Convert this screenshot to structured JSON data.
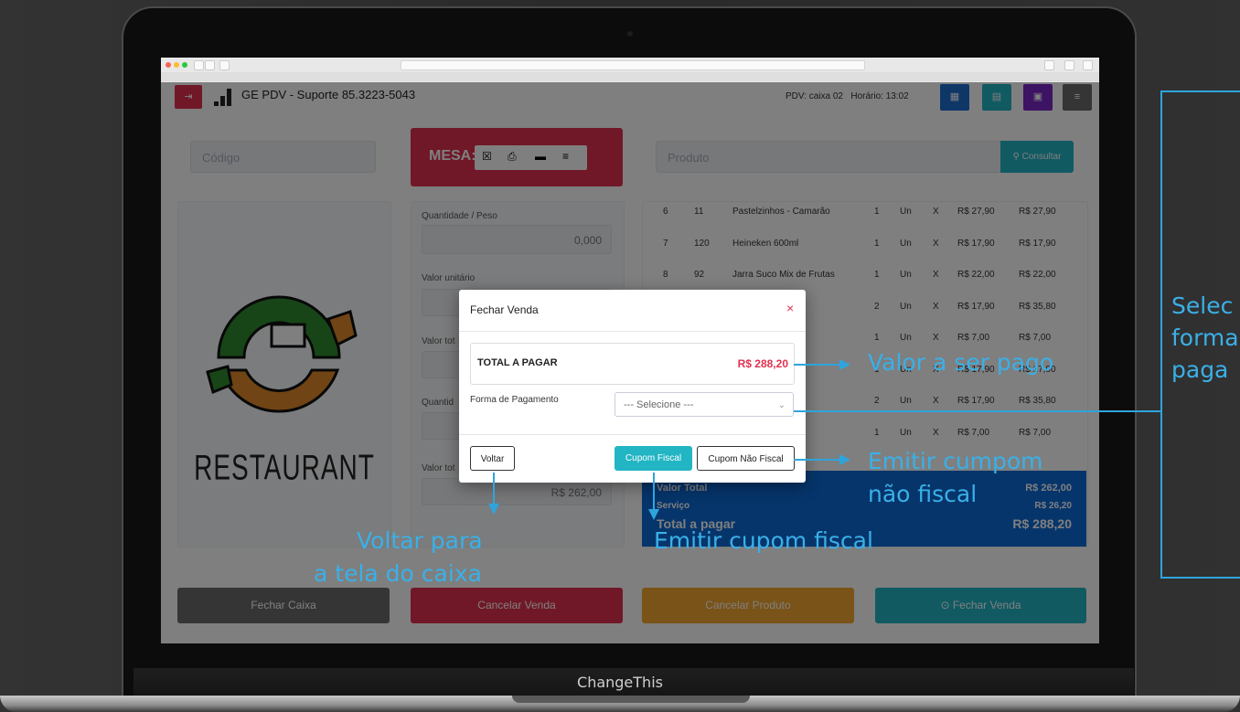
{
  "app": {
    "title": "GE PDV - Suporte 85.3223-5043",
    "pdv_label": "PDV: caixa 02",
    "time_label": "Horário: 13:02",
    "colors": {
      "red": "#e0314f",
      "blue": "#1d6fd0",
      "teal": "#22b5c4",
      "purple": "#7a27c9",
      "gray": "#6b6b6b",
      "orange": "#f2a62f"
    }
  },
  "search": {
    "codigo_placeholder": "Código",
    "produto_placeholder": "Produto",
    "consultar_label": "Consultar"
  },
  "mesa": {
    "label": "MESA:"
  },
  "form": {
    "qty_label": "Quantidade / Peso",
    "qty_value": "0,000",
    "unit_label": "Valor unitário",
    "total_label_short": "Valor tot",
    "qty_label_short": "Quantid",
    "total_label_short2": "Valor tot",
    "valor_total_value": "R$ 262,00"
  },
  "logo": {
    "text": "RESTAURANT"
  },
  "items": [
    {
      "n": "6",
      "cod": "11",
      "desc": "Pastelzinhos - Camarão",
      "qtd": "1",
      "un": "Un",
      "x": "X",
      "unit": "R$ 27,90",
      "total": "R$ 27,90"
    },
    {
      "n": "7",
      "cod": "120",
      "desc": "Heineken 600ml",
      "qtd": "1",
      "un": "Un",
      "x": "X",
      "unit": "R$ 17,90",
      "total": "R$ 17,90"
    },
    {
      "n": "8",
      "cod": "92",
      "desc": "Jarra Suco Mix de Frutas",
      "qtd": "1",
      "un": "Un",
      "x": "X",
      "unit": "R$ 22,00",
      "total": "R$ 22,00"
    },
    {
      "n": "",
      "cod": "",
      "desc": "",
      "qtd": "2",
      "un": "Un",
      "x": "X",
      "unit": "R$ 17,90",
      "total": "R$ 35,80"
    },
    {
      "n": "",
      "cod": "",
      "desc": "",
      "qtd": "1",
      "un": "Un",
      "x": "X",
      "unit": "R$ 7,00",
      "total": "R$ 7,00"
    },
    {
      "n": "",
      "cod": "",
      "desc": "",
      "qtd": "1",
      "un": "Un",
      "x": "X",
      "unit": "R$ 17,90",
      "total": "R$ 17,90"
    },
    {
      "n": "",
      "cod": "",
      "desc": "",
      "qtd": "2",
      "un": "Un",
      "x": "X",
      "unit": "R$ 17,90",
      "total": "R$ 35,80"
    },
    {
      "n": "",
      "cod": "",
      "desc": "",
      "qtd": "1",
      "un": "Un",
      "x": "X",
      "unit": "R$ 7,00",
      "total": "R$ 7,00"
    }
  ],
  "summary": {
    "valor_total_label": "Valor Total",
    "valor_total": "R$ 262,00",
    "servico_label": "Serviço",
    "servico": "R$ 26,20",
    "total_pagar_label": "Total a pagar",
    "total_pagar": "R$ 288,20"
  },
  "actions": {
    "fechar_caixa": "Fechar Caixa",
    "cancelar_venda": "Cancelar Venda",
    "cancelar_produto": "Cancelar Produto",
    "fechar_venda": "Fechar Venda"
  },
  "modal": {
    "title": "Fechar Venda",
    "close": "×",
    "total_label": "TOTAL A PAGAR",
    "total_value": "R$ 288,20",
    "forma_label": "Forma de Pagamento",
    "select_value": "--- Selecione ---",
    "voltar": "Voltar",
    "cupom_fiscal": "Cupom Fiscal",
    "cupom_nao_fiscal": "Cupom Não Fiscal"
  },
  "annotations": {
    "valor": "Valor a ser pago",
    "emitir_nao_fiscal_1": "Emitir cumpom",
    "emitir_nao_fiscal_2": "não fiscal",
    "emitir_fiscal": "Emitir cupom fiscal",
    "voltar_1": "Voltar para",
    "voltar_2": "a tela do caixa",
    "selec_1": "Selec",
    "selec_2": "forma",
    "selec_3": "paga"
  },
  "footer": {
    "brand": "ChangeThis"
  }
}
